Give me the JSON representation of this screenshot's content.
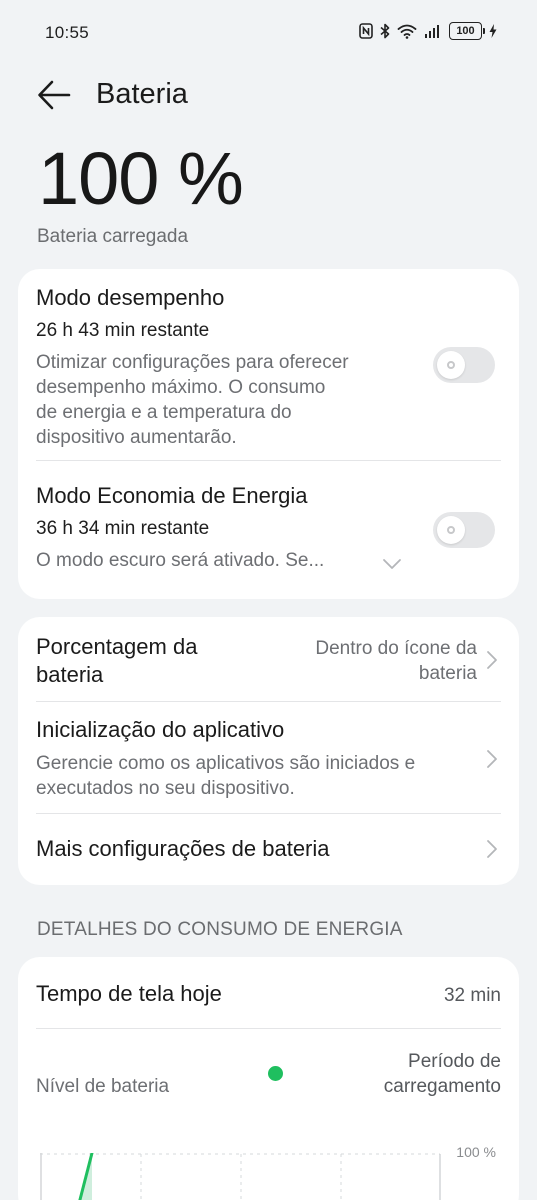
{
  "status_bar": {
    "time": "10:55",
    "battery_level": "100"
  },
  "header": {
    "title": "Bateria"
  },
  "battery": {
    "percent": "100 %",
    "status": "Bateria carregada"
  },
  "modes": {
    "performance": {
      "title": "Modo desempenho",
      "remaining": "26 h 43 min restante",
      "description_lines": [
        "Otimizar configurações para oferecer",
        "desempenho máximo. O consumo",
        "de energia e a temperatura do",
        "dispositivo aumentarão."
      ],
      "enabled": false
    },
    "power_saving": {
      "title": "Modo Economia de Energia",
      "remaining": "36 h 34 min restante",
      "description": "O modo escuro será ativado. Se...",
      "enabled": false
    }
  },
  "settings": {
    "battery_percentage": {
      "title_lines": [
        "Porcentagem da",
        "bateria"
      ],
      "value_lines": [
        "Dentro do ícone da",
        "bateria"
      ]
    },
    "app_launch": {
      "title": "Inicialização do aplicativo",
      "description_lines": [
        "Gerencie como os aplicativos são iniciados e",
        "executados no seu dispositivo."
      ]
    },
    "more": {
      "title": "Mais configurações de bateria"
    }
  },
  "usage": {
    "section_heading": "DETALHES DO CONSUMO DE ENERGIA",
    "screen_time_label": "Tempo de tela hoje",
    "screen_time_value": "32 min",
    "battery_level_label": "Nível de bateria",
    "charging_period_lines": [
      "Período de",
      "carregamento"
    ],
    "y_max_label": "100 %"
  },
  "colors": {
    "background": "#f1f3f5",
    "card": "#ffffff",
    "charging_green": "#1fbf5f"
  },
  "icons": {
    "back": "arrow-left-icon",
    "nfc": "nfc-icon",
    "bluetooth": "bluetooth-icon",
    "wifi": "wifi-icon",
    "signal": "signal-icon",
    "battery": "battery-icon",
    "charging": "charging-bolt-icon",
    "chevron_right": "chevron-right-icon",
    "chevron_down": "chevron-down-icon"
  }
}
